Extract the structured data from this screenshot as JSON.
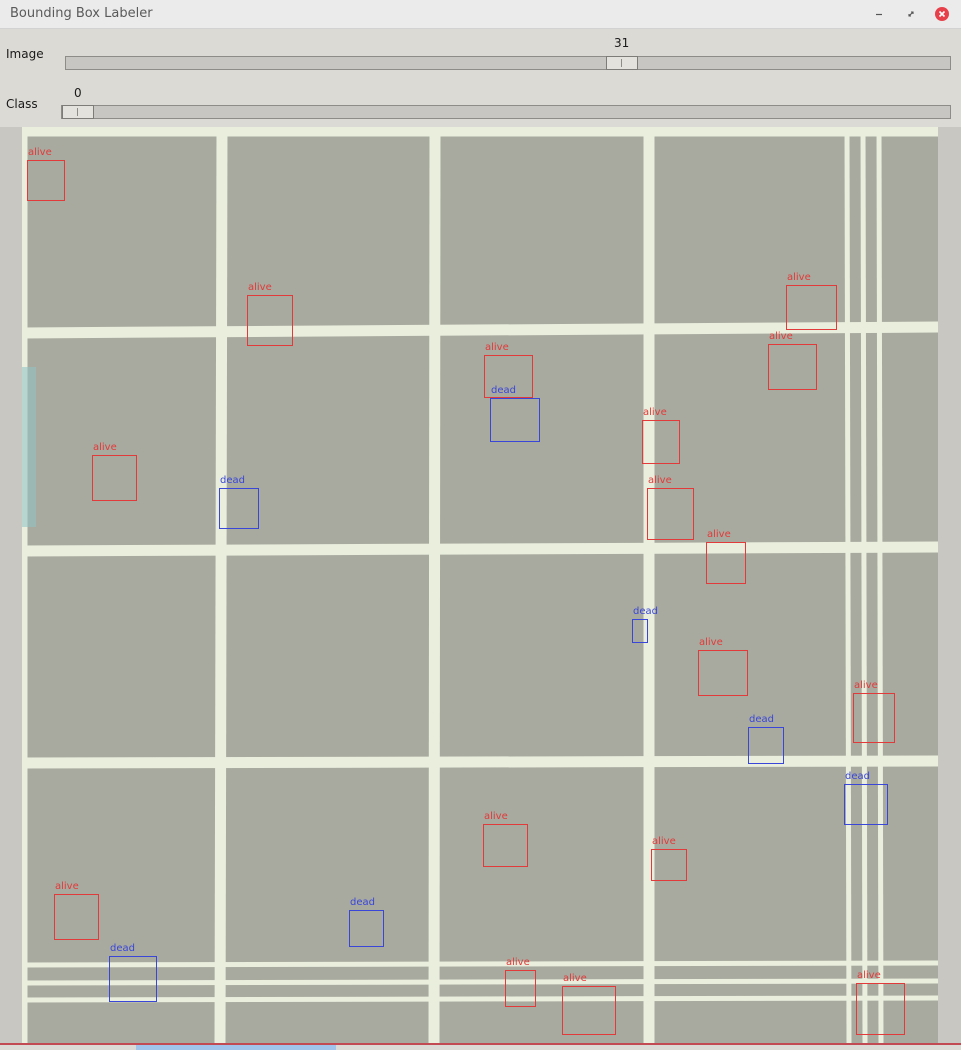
{
  "window": {
    "title": "Bounding Box Labeler"
  },
  "controls": {
    "image": {
      "label": "Image",
      "value": "31"
    },
    "class": {
      "label": "Class",
      "value": "0"
    }
  },
  "icons": {
    "minimize": "minimize-icon",
    "maximize": "maximize-icon",
    "close": "close-icon"
  },
  "colors": {
    "alive": "#e23a3a",
    "dead": "#3a46d8",
    "close": "#e8404a"
  },
  "labels": [
    {
      "text": "alive",
      "cls": "alive"
    },
    {
      "text": "alive",
      "cls": "alive"
    },
    {
      "text": "alive",
      "cls": "alive"
    },
    {
      "text": "alive",
      "cls": "alive"
    },
    {
      "text": "alive",
      "cls": "alive"
    },
    {
      "text": "dead",
      "cls": "dead"
    },
    {
      "text": "alive",
      "cls": "alive"
    },
    {
      "text": "alive",
      "cls": "alive"
    },
    {
      "text": "dead",
      "cls": "dead"
    },
    {
      "text": "alive",
      "cls": "alive"
    },
    {
      "text": "alive",
      "cls": "alive"
    },
    {
      "text": "dead",
      "cls": "dead"
    },
    {
      "text": "alive",
      "cls": "alive"
    },
    {
      "text": "alive",
      "cls": "alive"
    },
    {
      "text": "dead",
      "cls": "dead"
    },
    {
      "text": "dead",
      "cls": "dead"
    },
    {
      "text": "alive",
      "cls": "alive"
    },
    {
      "text": "alive",
      "cls": "alive"
    },
    {
      "text": "alive",
      "cls": "alive"
    },
    {
      "text": "dead",
      "cls": "dead"
    },
    {
      "text": "dead",
      "cls": "dead"
    },
    {
      "text": "alive",
      "cls": "alive"
    },
    {
      "text": "alive",
      "cls": "alive"
    },
    {
      "text": "alive",
      "cls": "alive"
    }
  ]
}
